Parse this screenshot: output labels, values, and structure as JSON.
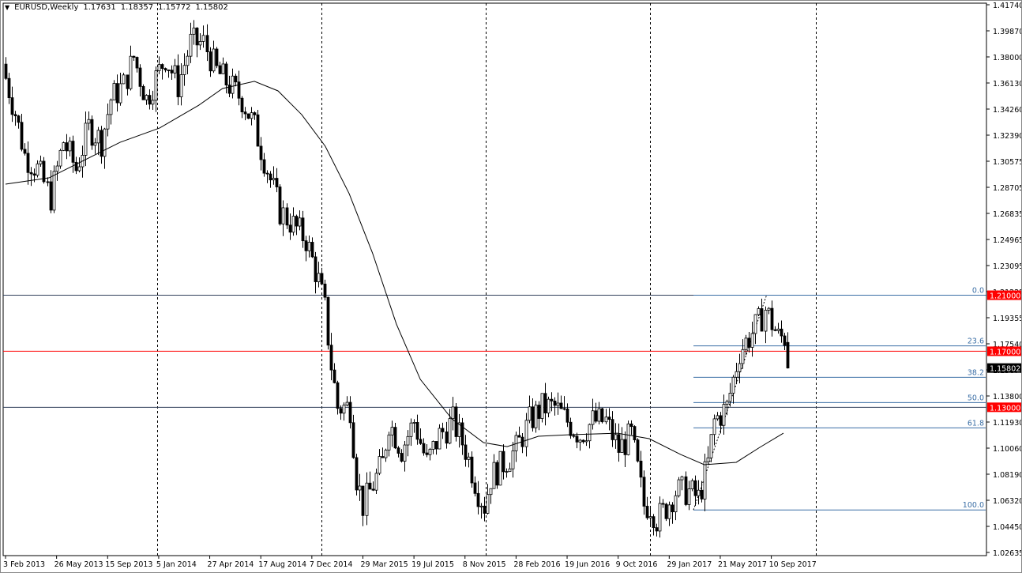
{
  "header": {
    "symbol_timeframe": "EURUSD,Weekly",
    "open": "1.17631",
    "high": "1.18357",
    "low": "1.15772",
    "close": "1.15802"
  },
  "chart_data": {
    "type": "candlestick",
    "title": "EURUSD,Weekly",
    "ylim": [
      1.02635,
      1.4174
    ],
    "y_ticks": [
      "1.41740",
      "1.39870",
      "1.38000",
      "1.36130",
      "1.34260",
      "1.32390",
      "1.30575",
      "1.28705",
      "1.26835",
      "1.24965",
      "1.23095",
      "1.21225",
      "1.19355",
      "1.17540",
      "1.15670",
      "1.13800",
      "1.11930",
      "1.10060",
      "1.08190",
      "1.06320",
      "1.04450",
      "1.02635"
    ],
    "x_ticks": [
      {
        "week": 0,
        "label": "3 Feb 2013"
      },
      {
        "week": 16,
        "label": "26 May 2013"
      },
      {
        "week": 32,
        "label": "15 Sep 2013"
      },
      {
        "week": 48,
        "label": "5 Jan 2014"
      },
      {
        "week": 64,
        "label": "27 Apr 2014"
      },
      {
        "week": 80,
        "label": "17 Aug 2014"
      },
      {
        "week": 96,
        "label": "7 Dec 2014"
      },
      {
        "week": 112,
        "label": "29 Mar 2015"
      },
      {
        "week": 128,
        "label": "19 Jul 2015"
      },
      {
        "week": 144,
        "label": "8 Nov 2015"
      },
      {
        "week": 160,
        "label": "28 Feb 2016"
      },
      {
        "week": 176,
        "label": "19 Jun 2016"
      },
      {
        "week": 192,
        "label": "9 Oct 2016"
      },
      {
        "week": 208,
        "label": "29 Jan 2017"
      },
      {
        "week": 224,
        "label": "21 May 2017"
      },
      {
        "week": 240,
        "label": "10 Sep 2017"
      }
    ],
    "year_separators_week": [
      47.5,
      99,
      150.5,
      202,
      254
    ],
    "close_anchors": [
      [
        0,
        1.365
      ],
      [
        3,
        1.34
      ],
      [
        6,
        1.31
      ],
      [
        10,
        1.3
      ],
      [
        14,
        1.28
      ],
      [
        18,
        1.32
      ],
      [
        22,
        1.3
      ],
      [
        26,
        1.33
      ],
      [
        30,
        1.32
      ],
      [
        33,
        1.35
      ],
      [
        37,
        1.36
      ],
      [
        40,
        1.38
      ],
      [
        44,
        1.35
      ],
      [
        48,
        1.37
      ],
      [
        50,
        1.38
      ],
      [
        54,
        1.36
      ],
      [
        58,
        1.39
      ],
      [
        62,
        1.39
      ],
      [
        64,
        1.38
      ],
      [
        66,
        1.37
      ],
      [
        70,
        1.36
      ],
      [
        74,
        1.35
      ],
      [
        78,
        1.33
      ],
      [
        82,
        1.3
      ],
      [
        86,
        1.27
      ],
      [
        90,
        1.26
      ],
      [
        94,
        1.25
      ],
      [
        98,
        1.22
      ],
      [
        100,
        1.2
      ],
      [
        102,
        1.16
      ],
      [
        104,
        1.13
      ],
      [
        108,
        1.13
      ],
      [
        110,
        1.08
      ],
      [
        112,
        1.06
      ],
      [
        114,
        1.07
      ],
      [
        118,
        1.09
      ],
      [
        120,
        1.12
      ],
      [
        124,
        1.1
      ],
      [
        128,
        1.12
      ],
      [
        132,
        1.09
      ],
      [
        136,
        1.11
      ],
      [
        140,
        1.12
      ],
      [
        144,
        1.1
      ],
      [
        148,
        1.07
      ],
      [
        150,
        1.06
      ],
      [
        152,
        1.08
      ],
      [
        156,
        1.09
      ],
      [
        160,
        1.1
      ],
      [
        164,
        1.12
      ],
      [
        168,
        1.13
      ],
      [
        172,
        1.13
      ],
      [
        176,
        1.12
      ],
      [
        180,
        1.11
      ],
      [
        184,
        1.12
      ],
      [
        188,
        1.12
      ],
      [
        192,
        1.1
      ],
      [
        196,
        1.11
      ],
      [
        200,
        1.06
      ],
      [
        202,
        1.06
      ],
      [
        204,
        1.05
      ],
      [
        206,
        1.055
      ],
      [
        210,
        1.07
      ],
      [
        214,
        1.07
      ],
      [
        217,
        1.065
      ],
      [
        220,
        1.09
      ],
      [
        222,
        1.12
      ],
      [
        226,
        1.13
      ],
      [
        230,
        1.17
      ],
      [
        233,
        1.18
      ],
      [
        236,
        1.19
      ],
      [
        238,
        1.2
      ],
      [
        240,
        1.19
      ],
      [
        242,
        1.18
      ],
      [
        244,
        1.18
      ],
      [
        245,
        1.158
      ]
    ],
    "moving_average": [
      [
        0,
        1.2893
      ],
      [
        13.6,
        1.2938
      ],
      [
        23.5,
        1.3051
      ],
      [
        35.9,
        1.3192
      ],
      [
        48.3,
        1.3294
      ],
      [
        60.6,
        1.3457
      ],
      [
        68,
        1.3576
      ],
      [
        78,
        1.3627
      ],
      [
        85.4,
        1.3559
      ],
      [
        92.8,
        1.339
      ],
      [
        100.2,
        1.3164
      ],
      [
        107.7,
        1.2825
      ],
      [
        115,
        1.2402
      ],
      [
        122.5,
        1.1894
      ],
      [
        130,
        1.1499
      ],
      [
        139.9,
        1.1217
      ],
      [
        149.8,
        1.1048
      ],
      [
        157.2,
        1.1019
      ],
      [
        167,
        1.1093
      ],
      [
        177,
        1.1104
      ],
      [
        191.8,
        1.1115
      ],
      [
        201.7,
        1.1076
      ],
      [
        211.6,
        1.0963
      ],
      [
        219,
        1.089
      ],
      [
        229,
        1.0907
      ],
      [
        236.4,
        1.1014
      ],
      [
        243.8,
        1.1115
      ]
    ],
    "horizontal_lines": [
      {
        "price": 1.21,
        "label": "1.21000",
        "color": "#2f3f5a"
      },
      {
        "price": 1.17,
        "label": "1.17000",
        "color": "#ff0000"
      },
      {
        "price": 1.13,
        "label": "1.13000",
        "color": "#2f3f5a"
      }
    ],
    "current_price": {
      "price": 1.15802,
      "label": "1.15802"
    },
    "fibonacci": {
      "high": 1.21,
      "low": 1.0567,
      "start_week": 215.6,
      "end_week": 238.5,
      "levels": [
        {
          "pct": 0,
          "label": "0.0"
        },
        {
          "pct": 23.6,
          "label": "23.6"
        },
        {
          "pct": 38.2,
          "label": "38.2"
        },
        {
          "pct": 50,
          "label": "50.0"
        },
        {
          "pct": 61.8,
          "label": "61.8"
        },
        {
          "pct": 100,
          "label": "100.0"
        }
      ]
    }
  }
}
